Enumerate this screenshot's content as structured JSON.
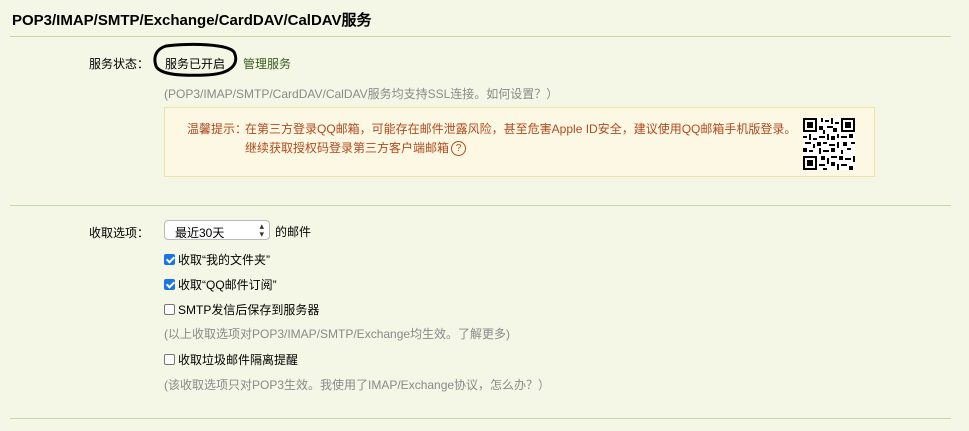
{
  "header": {
    "title": "POP3/IMAP/SMTP/Exchange/CardDAV/CalDAV服务"
  },
  "service": {
    "label": "服务状态：",
    "status": "服务已开启",
    "manage": "管理服务",
    "hint": "(POP3/IMAP/SMTP/CardDAV/CalDAV服务均支持SSL连接。如何设置？）"
  },
  "warning": {
    "label": "温馨提示：",
    "line1": "在第三方登录QQ邮箱，可能存在邮件泄露风险，甚至危害Apple ID安全，建议使用QQ邮箱手机版登录。",
    "line2": "继续获取授权码登录第三方客户端邮箱",
    "help_icon": "?",
    "icon": "qr-code-icon"
  },
  "receive": {
    "label": "收取选项：",
    "select_value": "最近30天",
    "suffix": "的邮件",
    "options": [
      {
        "label": "收取“我的文件夹”",
        "checked": true
      },
      {
        "label": "收取“QQ邮件订阅”",
        "checked": true
      },
      {
        "label": "SMTP发信后保存到服务器",
        "checked": false
      }
    ],
    "hint1": "(以上收取选项对POP3/IMAP/SMTP/Exchange均生效。了解更多)",
    "spam_option": {
      "label": "收取垃圾邮件隔离提醒",
      "checked": false
    },
    "hint2": "(该收取选项只对POP3生效。我使用了IMAP/Exchange协议，怎么办？）"
  },
  "colors": {
    "background": "#f4f6e6",
    "divider": "#c5d8a4",
    "warning_text": "#b04a1e",
    "link": "#3a5c1d",
    "checkbox": "#1a73e8"
  }
}
